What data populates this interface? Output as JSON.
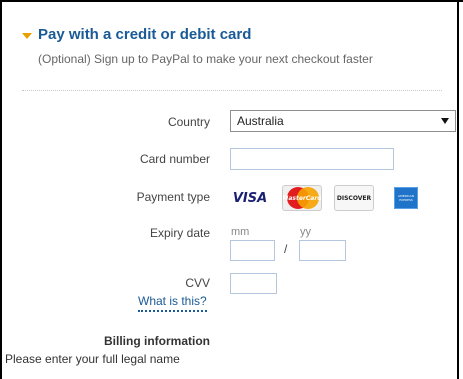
{
  "section": {
    "title": "Pay with a credit or debit card",
    "subtitle": "(Optional) Sign up to PayPal to make your next checkout faster"
  },
  "form": {
    "country_label": "Country",
    "country_value": "Australia",
    "card_number_label": "Card number",
    "card_number_value": "",
    "payment_type_label": "Payment type",
    "payment_types": [
      "VISA",
      "MasterCard",
      "DISCOVER",
      "AMERICAN EXPRESS"
    ],
    "expiry_label": "Expiry date",
    "expiry_month_hint": "mm",
    "expiry_year_hint": "yy",
    "expiry_separator": "/",
    "cvv_label": "CVV",
    "cvv_help_link": "What is this?"
  },
  "billing": {
    "heading": "Billing information",
    "note": "Please enter your full legal name"
  },
  "icons": {
    "caret": "caret-down-icon",
    "select_arrow": "chevron-down-icon"
  },
  "colors": {
    "title": "#1a5a96",
    "caret": "#e8a100",
    "link": "#1a5a96",
    "input_border": "#b5c7de"
  }
}
